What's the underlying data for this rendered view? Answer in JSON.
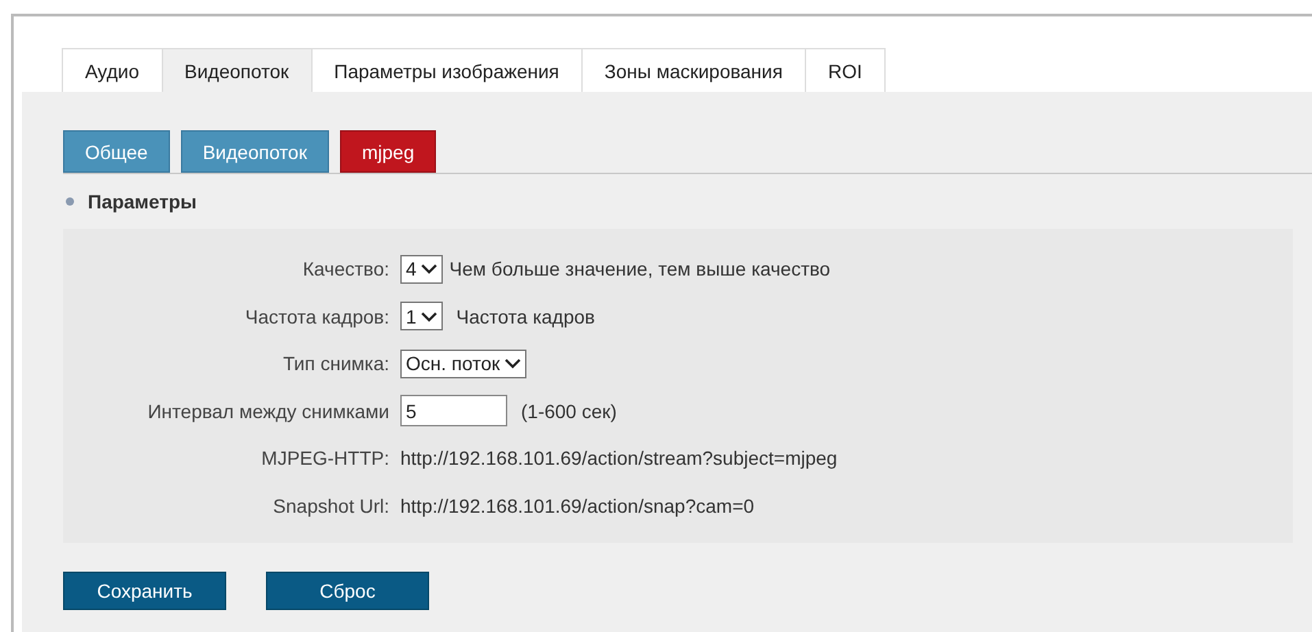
{
  "tabs": [
    {
      "label": "Аудио",
      "selected": false
    },
    {
      "label": "Видеопоток",
      "selected": true
    },
    {
      "label": "Параметры изображения",
      "selected": false
    },
    {
      "label": "Зоны маскирования",
      "selected": false
    },
    {
      "label": "ROI",
      "selected": false
    }
  ],
  "subtabs": [
    {
      "label": "Общее",
      "selected": false
    },
    {
      "label": "Видеопоток",
      "selected": false
    },
    {
      "label": "mjpeg",
      "selected": true
    }
  ],
  "section": {
    "title": "Параметры"
  },
  "fields": [
    {
      "kind": "select",
      "label": "Качество:",
      "value": "4",
      "hint": "Чем больше значение, тем выше качество"
    },
    {
      "kind": "select",
      "label": "Частота кадров:",
      "value": "1",
      "hint": "Частота кадров"
    },
    {
      "kind": "select",
      "label": "Тип снимка:",
      "value": "Осн. поток"
    },
    {
      "kind": "input",
      "label": "Интервал между снимками",
      "value": "5",
      "hint": "(1-600 сек)"
    },
    {
      "kind": "text",
      "label": "MJPEG-HTTP:",
      "value": "http://192.168.101.69/action/stream?subject=mjpeg"
    },
    {
      "kind": "text",
      "label": "Snapshot Url:",
      "value": "http://192.168.101.69/action/snap?cam=0"
    }
  ],
  "buttons": [
    "Сохранить",
    "Сброс"
  ]
}
